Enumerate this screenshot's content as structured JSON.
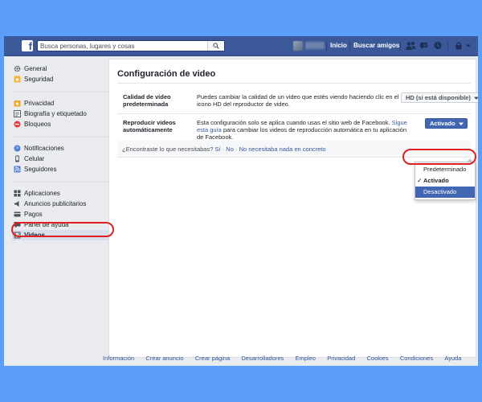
{
  "topbar": {
    "logo": "f",
    "search_placeholder": "Busca personas, lugares y cosas",
    "links": [
      "Inicio",
      "Buscar amigos"
    ],
    "icons": [
      "friend-requests-icon",
      "messages-icon",
      "notifications-icon",
      "lock-icon",
      "chevron-down-icon"
    ]
  },
  "sidebar": {
    "groups": [
      [
        {
          "label": "General",
          "icon": "gear-icon"
        },
        {
          "label": "Seguridad",
          "icon": "shield-icon"
        }
      ],
      [
        {
          "label": "Privacidad",
          "icon": "lock-icon"
        },
        {
          "label": "Biografía y etiquetado",
          "icon": "timeline-icon"
        },
        {
          "label": "Bloqueos",
          "icon": "block-icon"
        }
      ],
      [
        {
          "label": "Notificaciones",
          "icon": "globe-icon"
        },
        {
          "label": "Celular",
          "icon": "phone-icon"
        },
        {
          "label": "Seguidores",
          "icon": "rss-icon"
        }
      ],
      [
        {
          "label": "Aplicaciones",
          "icon": "apps-icon"
        },
        {
          "label": "Anuncios publicitarios",
          "icon": "ads-icon"
        },
        {
          "label": "Pagos",
          "icon": "payments-icon"
        },
        {
          "label": "Panel de ayuda",
          "icon": "help-icon"
        },
        {
          "label": "Videos",
          "icon": "film-icon"
        }
      ]
    ],
    "active": "Videos"
  },
  "main": {
    "title": "Configuración de video",
    "rows": [
      {
        "label": "Calidad de video predeterminada",
        "description": "Puedes cambiar la calidad de un video que estés viendo haciendo clic en el icono HD del reproductor de video.",
        "control": "HD (si está disponible)"
      },
      {
        "label": "Reproducir videos automáticamente",
        "description_before": "Esta configuración solo se aplica cuando usas el sitio web de Facebook.",
        "description_link": "Sigue esta guía",
        "description_after": "para cambiar los videos de reproducción automática en tu aplicación de Facebook.",
        "control": "Activado"
      }
    ],
    "feedback": {
      "question": "¿Encontraste lo que necesitabas?",
      "yes": "Sí",
      "no": "No",
      "none": "No necesitaba nada en concreto",
      "separator": "·"
    },
    "autoplay_menu": {
      "options": [
        "Predeterminado",
        "Activado",
        "Desactivado"
      ],
      "checked": "Activado",
      "highlighted": "Desactivado"
    }
  },
  "footer": {
    "links": [
      "Información",
      "Crear anuncio",
      "Crear página",
      "Desarrolladores",
      "Empleo",
      "Privacidad",
      "Cookies",
      "Condiciones",
      "Ayuda"
    ]
  },
  "colors": {
    "background": "#5b9ef7",
    "brand": "#3b5998",
    "link": "#365899",
    "highlight_circle": "#e0201e"
  }
}
